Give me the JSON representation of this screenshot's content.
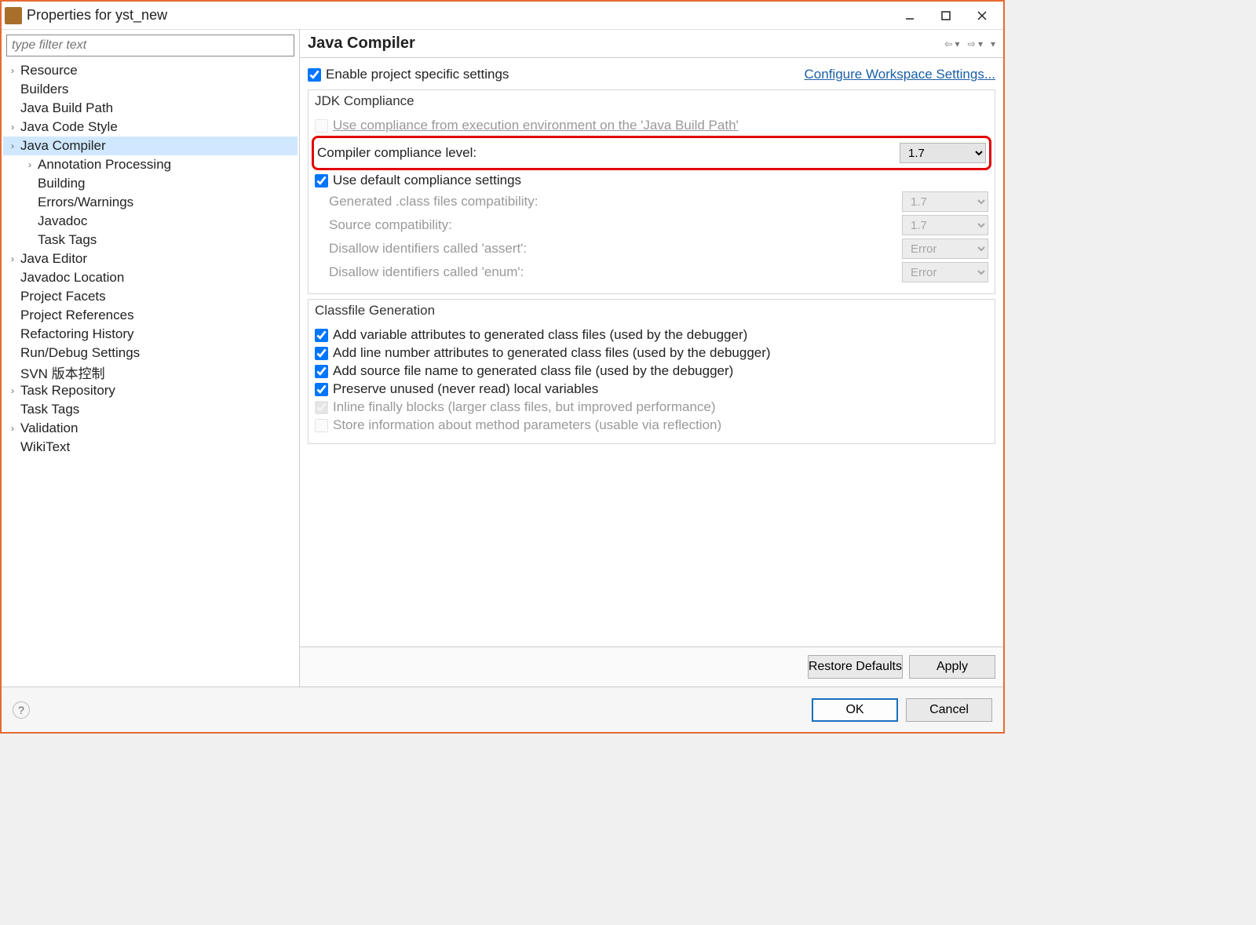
{
  "window": {
    "title": "Properties for yst_new"
  },
  "filter": {
    "placeholder": "type filter text"
  },
  "tree": {
    "items": [
      {
        "label": "Resource",
        "exp": true,
        "level": 0
      },
      {
        "label": "Builders",
        "exp": false,
        "level": 0
      },
      {
        "label": "Java Build Path",
        "exp": false,
        "level": 0
      },
      {
        "label": "Java Code Style",
        "exp": true,
        "level": 0
      },
      {
        "label": "Java Compiler",
        "exp": true,
        "level": 0,
        "sel": true
      },
      {
        "label": "Annotation Processing",
        "exp": true,
        "level": 1
      },
      {
        "label": "Building",
        "exp": false,
        "level": 1
      },
      {
        "label": "Errors/Warnings",
        "exp": false,
        "level": 1
      },
      {
        "label": "Javadoc",
        "exp": false,
        "level": 1
      },
      {
        "label": "Task Tags",
        "exp": false,
        "level": 1
      },
      {
        "label": "Java Editor",
        "exp": true,
        "level": 0
      },
      {
        "label": "Javadoc Location",
        "exp": false,
        "level": 0
      },
      {
        "label": "Project Facets",
        "exp": false,
        "level": 0
      },
      {
        "label": "Project References",
        "exp": false,
        "level": 0
      },
      {
        "label": "Refactoring History",
        "exp": false,
        "level": 0
      },
      {
        "label": "Run/Debug Settings",
        "exp": false,
        "level": 0
      },
      {
        "label": "SVN 版本控制",
        "exp": false,
        "level": 0
      },
      {
        "label": "Task Repository",
        "exp": true,
        "level": 0
      },
      {
        "label": "Task Tags",
        "exp": false,
        "level": 0
      },
      {
        "label": "Validation",
        "exp": true,
        "level": 0
      },
      {
        "label": "WikiText",
        "exp": false,
        "level": 0
      }
    ]
  },
  "page": {
    "title": "Java Compiler",
    "enable_project": "Enable project specific settings",
    "config_link": "Configure Workspace Settings...",
    "jdk": {
      "header": "JDK Compliance",
      "use_exec_env": "Use compliance from execution environment on the 'Java Build Path'",
      "ccl_label": "Compiler compliance level:",
      "ccl_value": "1.7",
      "use_default": "Use default compliance settings",
      "gen_class": "Generated .class files compatibility:",
      "gen_class_v": "1.7",
      "src_compat": "Source compatibility:",
      "src_compat_v": "1.7",
      "dis_assert": "Disallow identifiers called 'assert':",
      "dis_assert_v": "Error",
      "dis_enum": "Disallow identifiers called 'enum':",
      "dis_enum_v": "Error"
    },
    "classfile": {
      "header": "Classfile Generation",
      "c1": "Add variable attributes to generated class files (used by the debugger)",
      "c2": "Add line number attributes to generated class files (used by the debugger)",
      "c3": "Add source file name to generated class file (used by the debugger)",
      "c4": "Preserve unused (never read) local variables",
      "c5": "Inline finally blocks (larger class files, but improved performance)",
      "c6": "Store information about method parameters (usable via reflection)"
    },
    "restore": "Restore Defaults",
    "apply": "Apply"
  },
  "footer": {
    "ok": "OK",
    "cancel": "Cancel"
  }
}
